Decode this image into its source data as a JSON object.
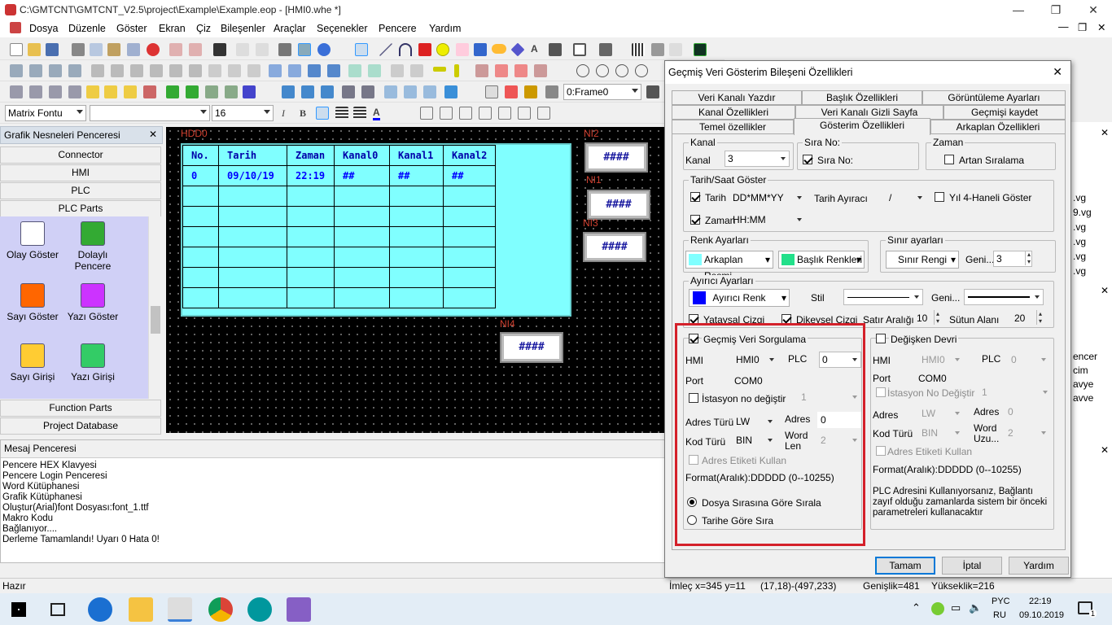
{
  "window": {
    "title": "C:\\GMTCNT\\GMTCNT_V2.5\\project\\Example\\Example.eop - [HMI0.whe *]"
  },
  "menu": [
    "Dosya",
    "Düzenle",
    "Göster",
    "Ekran",
    "Çiz",
    "Bileşenler",
    "Araçlar",
    "Seçenekler",
    "Pencere",
    "Yardım"
  ],
  "toolbar": {
    "frame_combo": "0:Frame0",
    "font_combo": "Matrix Fontu",
    "size_combo": "16"
  },
  "left": {
    "title": "Grafik Nesneleri Penceresi",
    "nav_top": [
      "Connector",
      "HMI",
      "PLC",
      "PLC Parts"
    ],
    "nav_bottom": [
      "Function Parts",
      "Project Database"
    ],
    "items": [
      {
        "l1": "Olay Göster",
        "l2": ""
      },
      {
        "l1": "Dolaylı",
        "l2": "Pencere"
      },
      {
        "l1": "Sayı Göster",
        "l2": ""
      },
      {
        "l1": "Yazı Göster",
        "l2": ""
      },
      {
        "l1": "Sayı Girişi",
        "l2": ""
      },
      {
        "l1": "Yazı Girişi",
        "l2": ""
      }
    ]
  },
  "canvas": {
    "hdd_label": "HDD0",
    "headers": [
      "No.",
      "Tarih",
      "Zaman",
      "Kanal0",
      "Kanal1",
      "Kanal2"
    ],
    "row": [
      "0",
      "09/10/19",
      "22:19",
      "##",
      "##",
      "##"
    ],
    "ni": [
      {
        "label": "NI2",
        "value": "####"
      },
      {
        "label": "NI1",
        "value": "####"
      },
      {
        "label": "NI3",
        "value": "####"
      },
      {
        "label": "NI4",
        "value": "####"
      }
    ]
  },
  "messages": {
    "title": "Mesaj Penceresi",
    "lines": [
      "Pencere HEX Klavyesi",
      "Pencere Login Penceresi",
      "Word Kütüphanesi",
      "Grafik Kütüphanesi",
      "Oluştur(Arial)font Dosyası:font_1.ttf",
      "Makro Kodu",
      "Bağlanıyor....",
      "Derleme Tamamlandı! Uyarı 0 Hata 0!"
    ]
  },
  "status": {
    "left": "Hazır",
    "cursor": "İmleç x=345  y=11",
    "coords": "(17,18)-(497,233)",
    "width": "Genişlik=481",
    "height": "Yükseklik=216"
  },
  "right_files": [
    ".vg",
    "9.vg",
    ".vg",
    ".vg",
    ".vg",
    ".vg"
  ],
  "right_keys": [
    "encer",
    "cim",
    "avye",
    "avve"
  ],
  "dialog": {
    "title": "Geçmiş Veri Gösterim Bileşeni Özellikleri",
    "tabs_row1": [
      "Veri Kanalı Yazdır",
      "Başlık Özellikleri",
      "Görüntüleme Ayarları"
    ],
    "tabs_row2": [
      "Kanal Özellikleri",
      "Veri Kanalı Gizli Sayfa",
      "Geçmişi kaydet"
    ],
    "tabs_row3": [
      "Temel özellikler",
      "Gösterim Özellikleri",
      "Arkaplan Özellikleri"
    ],
    "kanal": {
      "group": "Kanal",
      "label": "Kanal",
      "value": "3"
    },
    "sira": {
      "group": "Sıra No:",
      "cb": "Sıra No:"
    },
    "zaman": {
      "group": "Zaman",
      "cb": "Artan Sıralama"
    },
    "tarih": {
      "group": "Tarih/Saat Göster",
      "tarih_cb": "Tarih",
      "tarih_fmt": "DD*MM*YY",
      "ayirac_lbl": "Tarih Ayıracı",
      "ayirac": "/",
      "yil_cb": "Yıl 4-Haneli Göster",
      "zaman_cb": "Zaman",
      "zaman_fmt": "HH:MM"
    },
    "renk": {
      "group": "Renk Ayarları",
      "bg": "Arkaplan Resmi",
      "title": "Başlık Renkleri",
      "bg_color": "#80ffff",
      "title_color": "#22e08a"
    },
    "sinir": {
      "group": "Sınır ayarları",
      "btn": "Sınır Rengi",
      "gen_lbl": "Geni...",
      "gen": "3"
    },
    "ayirici": {
      "group": "Ayırıcı Ayarları",
      "btn": "Ayırıcı Renk",
      "swatch": "#0000ff",
      "stil": "Stil",
      "gen_lbl": "Geni...",
      "yatay": "Yataysal Çizgi",
      "dikey": "Dikeysel Çizgi",
      "satir_lbl": "Satır Aralığı",
      "satir": "10",
      "sutun_lbl": "Sütun Alanı",
      "sutun": "20"
    },
    "gecmis": {
      "cb": "Geçmiş Veri Sorgulama",
      "hmi_lbl": "HMI",
      "hmi": "HMI0",
      "plc_lbl": "PLC",
      "plc": "0",
      "port_lbl": "Port",
      "port": "COM0",
      "istasyon_cb": "İstasyon no değiştir",
      "istasyon": "1",
      "adres_turu_lbl": "Adres Türü",
      "adres_turu": "LW",
      "adres_lbl": "Adres",
      "adres": "0",
      "kod_lbl": "Kod Türü",
      "kod": "BIN",
      "word_lbl": "Word Len",
      "word": "2",
      "etiket_cb": "Adres Etiketi Kullan",
      "format": "Format(Aralık):DDDDD (0--10255)",
      "r1": "Dosya Sırasına Göre Sırala",
      "r2": "Tarihe Göre Sıra"
    },
    "degisken": {
      "cb": "Değişken Devri",
      "hmi_lbl": "HMI",
      "hmi": "HMI0",
      "plc_lbl": "PLC",
      "plc": "0",
      "port_lbl": "Port",
      "port": "COM0",
      "istasyon_cb": "İstasyon No Değiştir",
      "istasyon": "1",
      "adres_lbl": "Adres",
      "adres_dd": "LW",
      "adres2_lbl": "Adres",
      "adres2": "0",
      "kod_lbl": "Kod Türü",
      "kod": "BIN",
      "word_lbl": "Word Uzu...",
      "word": "2",
      "etiket_cb": "Adres Etiketi Kullan",
      "format": "Format(Aralık):DDDDD (0--10255)",
      "note": "PLC Adresini Kullanıyorsanız, Bağlantı zayıf olduğu zamanlarda sistem bir önceki parametreleri kullanacaktır"
    },
    "buttons": {
      "ok": "Tamam",
      "cancel": "İptal",
      "help": "Yardım"
    }
  },
  "taskbar": {
    "lang1": "PYC",
    "lang2": "RU",
    "time": "22:19",
    "date": "09.10.2019",
    "notif": "1"
  }
}
